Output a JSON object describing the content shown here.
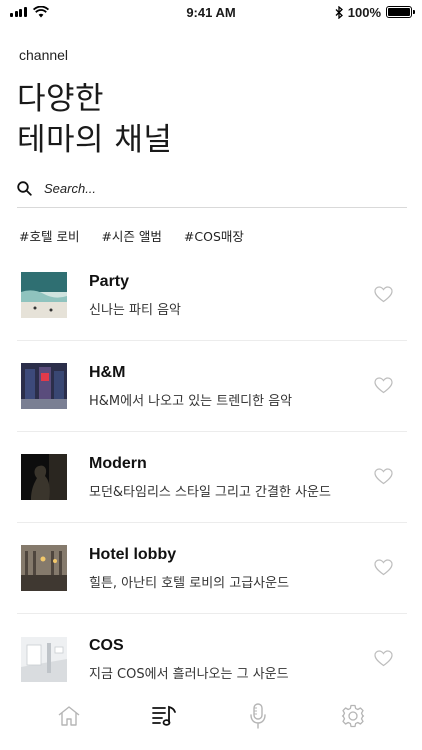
{
  "status_bar": {
    "time": "9:41 AM",
    "battery": "100%",
    "battery_level": 1.0
  },
  "header": {
    "section_label": "channel",
    "headline_line1": "다양한",
    "headline_line2": "테마의 채널"
  },
  "search": {
    "placeholder": "Search...",
    "icon": "search-icon"
  },
  "tags": [
    "#호텔 로비",
    "#시즌 앨범",
    "#COS매장"
  ],
  "channels": [
    {
      "title": "Party",
      "description": "신나는 파티 음악",
      "favorite": false,
      "icon": "heart-icon"
    },
    {
      "title": "H&M",
      "description": "H&M에서 나오고 있는 트렌디한 음악",
      "favorite": false,
      "icon": "heart-icon"
    },
    {
      "title": "Modern",
      "description": "모던&타임리스 스타일 그리고 간결한 사운드",
      "favorite": false,
      "icon": "heart-icon"
    },
    {
      "title": "Hotel lobby",
      "description": "힐튼, 아난티 호텔 로비의 고급사운드",
      "favorite": false,
      "icon": "heart-icon"
    },
    {
      "title": "COS",
      "description": "지금 COS에서 흘러나오는 그 사운드",
      "favorite": false,
      "icon": "heart-icon"
    }
  ],
  "tab_bar": {
    "active": "music",
    "tabs": [
      "home-icon",
      "music-icon",
      "microphone-icon",
      "settings-icon"
    ]
  },
  "colors": {
    "text": "#1a1a1a",
    "icon_inactive": "#b5b5b5",
    "icon_active": "#111111",
    "divider": "#ececec"
  }
}
